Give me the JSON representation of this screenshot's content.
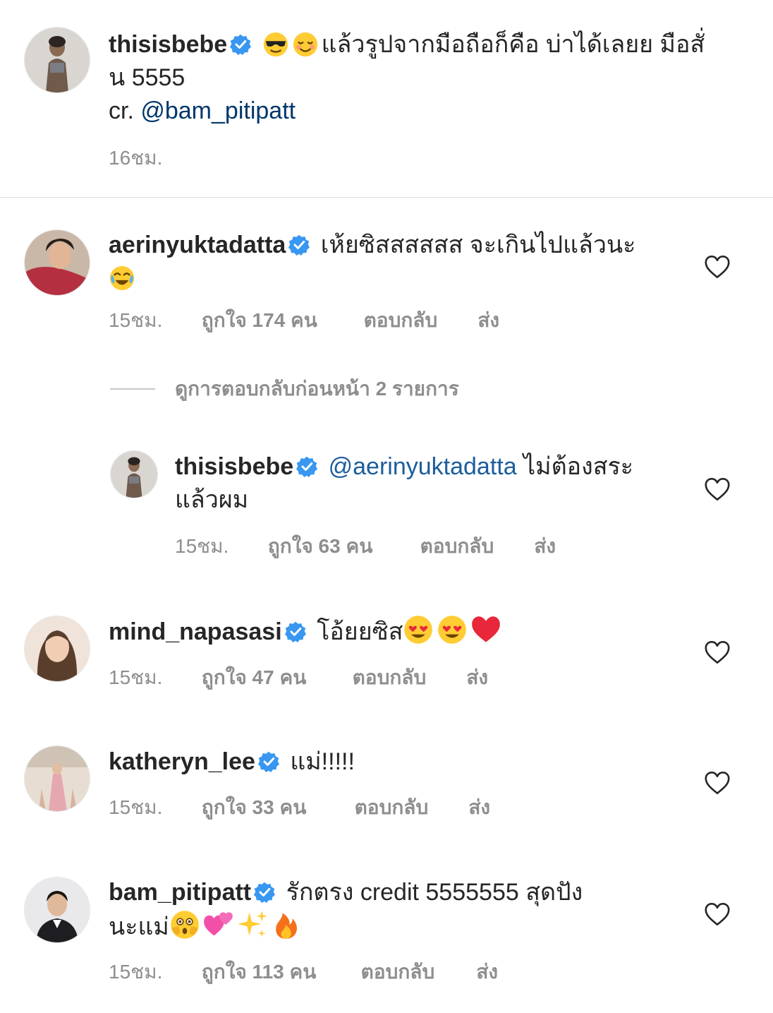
{
  "caption": {
    "username": "thisisbebe",
    "line1_text": "แล้วรูปจากมือถือก็คือ บ่าได้เลยย มือสั่",
    "line2_text": "น 5555",
    "credit_prefix": "cr. ",
    "credit_mention": "@bam_pitipatt",
    "time": "16ชม.",
    "emojis": [
      "smiling-face-with-sunglasses",
      "smiling-face"
    ]
  },
  "comments": [
    {
      "username": "aerinyuktadatta",
      "line1_text": "เห้ยซิสสสสสส จะเกินไปแล้วนะ",
      "time": "15ชม.",
      "likes": "ถูกใจ 174 คน",
      "reply": "ตอบกลับ",
      "send": "ส่ง",
      "emojis": [
        "face-with-tears-of-joy"
      ]
    },
    {
      "username": "thisisbebe",
      "mention": "@aerinyuktadatta",
      "line1_text": " ไม่ต้องสระ",
      "line2_text": "แล้วผม",
      "time": "15ชม.",
      "likes": "ถูกใจ 63 คน",
      "reply": "ตอบกลับ",
      "send": "ส่ง"
    },
    {
      "username": "mind_napasasi",
      "line1_text": "โอ้ยยซิส",
      "time": "15ชม.",
      "likes": "ถูกใจ 47 คน",
      "reply": "ตอบกลับ",
      "send": "ส่ง",
      "emojis": [
        "smiling-face-with-heart-eyes",
        "smiling-face-with-heart-eyes",
        "red-heart"
      ]
    },
    {
      "username": "katheryn_lee",
      "line1_text": "แม่!!!!!",
      "time": "15ชม.",
      "likes": "ถูกใจ 33 คน",
      "reply": "ตอบกลับ",
      "send": "ส่ง"
    },
    {
      "username": "bam_pitipatt",
      "line1_text": "รักตรง credit 5555555 สุดปัง",
      "line2_text": "นะแม่",
      "time": "15ชม.",
      "likes": "ถูกใจ 113 คน",
      "reply": "ตอบกลับ",
      "send": "ส่ง",
      "emojis": [
        "flushed-face-with-hands",
        "two-hearts",
        "sparkles",
        "fire"
      ]
    }
  ],
  "view_replies": "ดูการตอบกลับก่อนหน้า 2 รายการ",
  "colors": {
    "text": "#262626",
    "meta": "#8e8e8e",
    "verified": "#3897f0",
    "mention": "#00376b",
    "divider": "#dbdbdb"
  }
}
